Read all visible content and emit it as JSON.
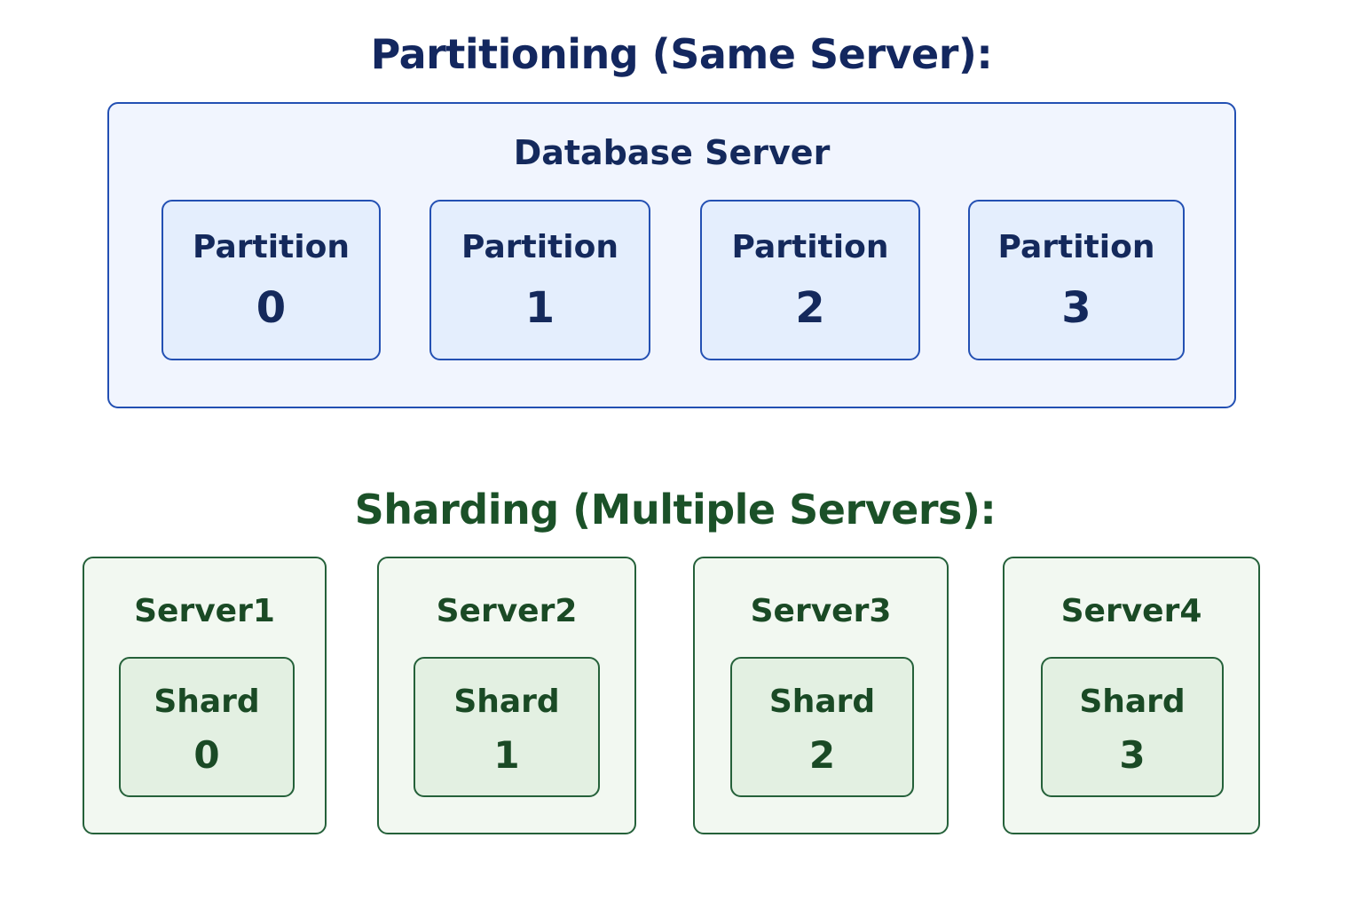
{
  "partitioning": {
    "title": "Partitioning (Same Server):",
    "server_label": "Database Server",
    "partitions": [
      {
        "label": "Partition",
        "number": "0"
      },
      {
        "label": "Partition",
        "number": "1"
      },
      {
        "label": "Partition",
        "number": "2"
      },
      {
        "label": "Partition",
        "number": "3"
      }
    ]
  },
  "sharding": {
    "title": "Sharding (Multiple Servers):",
    "servers": [
      {
        "label": "Server1",
        "shard_label": "Shard",
        "shard_number": "0"
      },
      {
        "label": "Server2",
        "shard_label": "Shard",
        "shard_number": "1"
      },
      {
        "label": "Server3",
        "shard_label": "Shard",
        "shard_number": "2"
      },
      {
        "label": "Server4",
        "shard_label": "Shard",
        "shard_number": "3"
      }
    ]
  },
  "colors": {
    "partition_border": "#2350b3",
    "partition_fill": "#e4eefd",
    "partition_text": "#13275f",
    "shard_border": "#25613a",
    "shard_fill": "#e3f0e2",
    "shard_text": "#1b5128"
  }
}
